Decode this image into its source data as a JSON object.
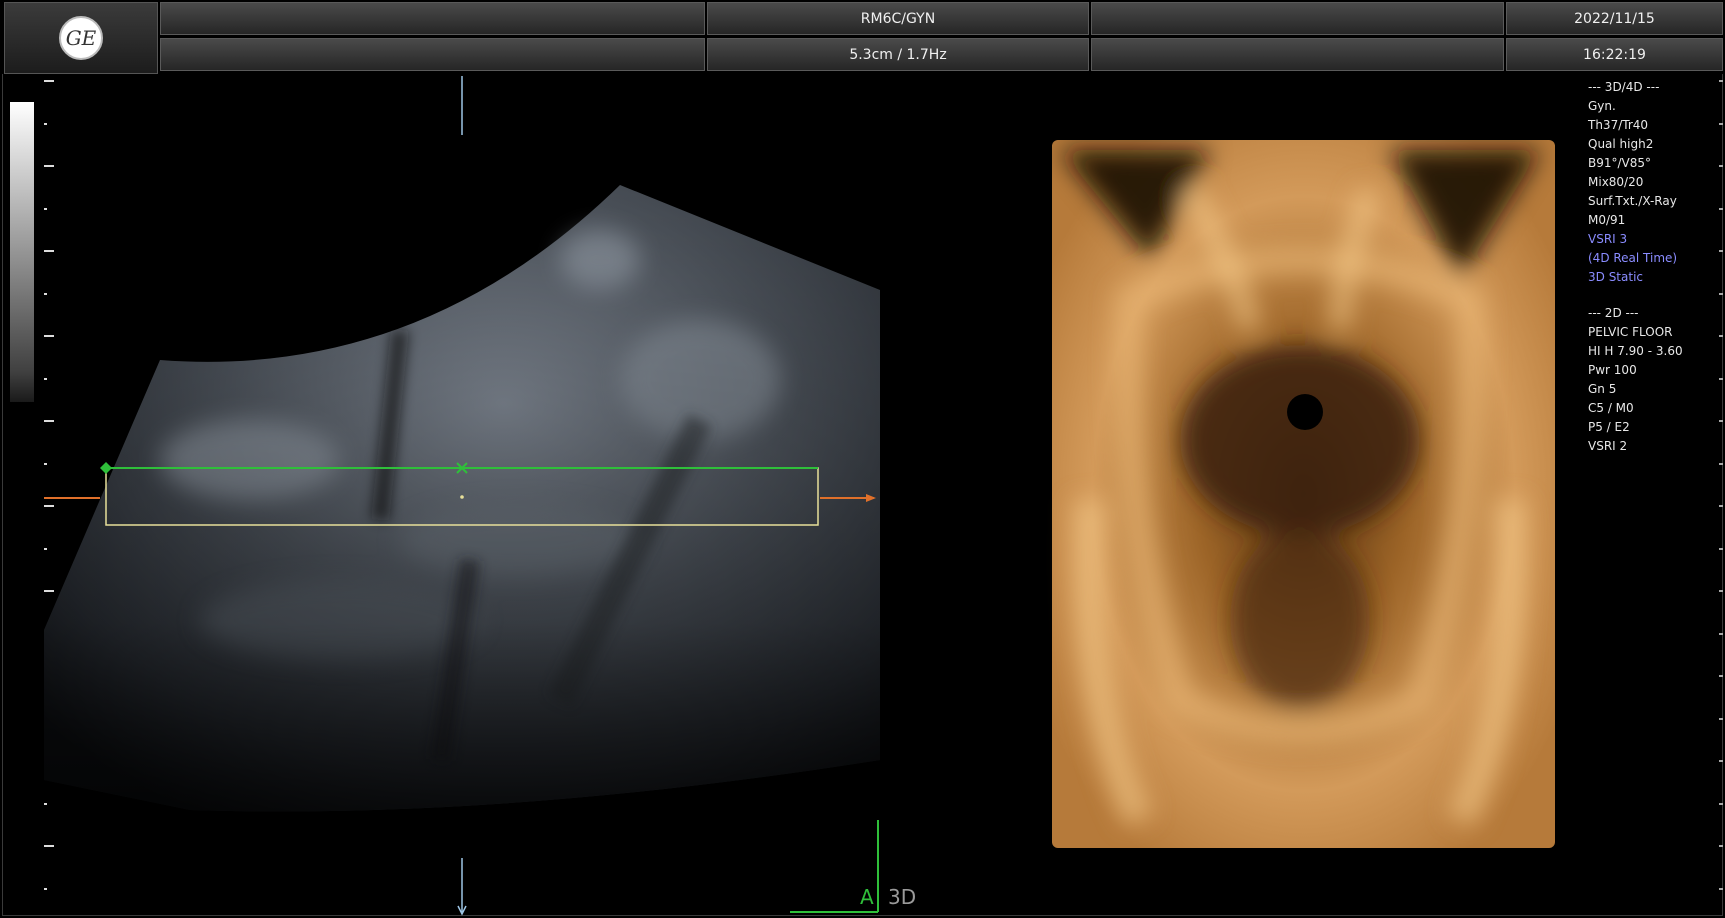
{
  "header": {
    "logo_text": "GE",
    "probe_preset": "RM6C/GYN",
    "depth_frequency": "5.3cm / 1.7Hz",
    "date": "2022/11/15",
    "time": "16:22:19"
  },
  "params_3d4d": [
    {
      "text": "--- 3D/4D ---",
      "blue": false
    },
    {
      "text": "Gyn.",
      "blue": false
    },
    {
      "text": "Th37/Tr40",
      "blue": false
    },
    {
      "text": "Qual high2",
      "blue": false
    },
    {
      "text": "B91°/V85°",
      "blue": false
    },
    {
      "text": "Mix80/20",
      "blue": false
    },
    {
      "text": "Surf.Txt./X-Ray",
      "blue": false
    },
    {
      "text": "M0/91",
      "blue": false
    },
    {
      "text": "VSRI 3",
      "blue": true
    },
    {
      "text": "(4D Real Time)",
      "blue": true
    },
    {
      "text": "3D Static",
      "blue": true
    }
  ],
  "params_2d": [
    "--- 2D ---",
    "PELVIC FLOOR",
    "HI H  7.90 - 3.60",
    "Pwr 100",
    "Gn  5",
    "C5 / M0",
    "P5 / E2",
    "VSRI 2"
  ],
  "view_labels": {
    "a": "A",
    "threed": "3D"
  },
  "colors": {
    "green_accent": "#2fbf3a",
    "orange_marker": "#e0702a",
    "roi_box": "#e8e09a",
    "rendering_tone": "#c98a45"
  }
}
